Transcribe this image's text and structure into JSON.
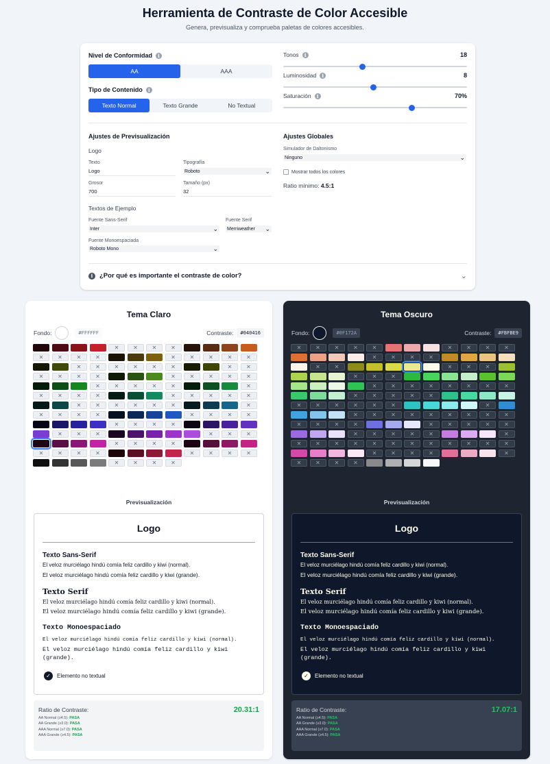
{
  "header": {
    "title": "Herramienta de Contraste de Color Accesible",
    "subtitle": "Genera, previsualiza y comprueba paletas de colores accesibles."
  },
  "settings": {
    "conformance": {
      "label": "Nivel de Conformidad",
      "options": [
        "AA",
        "AAA"
      ],
      "selected": "AA"
    },
    "content_type": {
      "label": "Tipo de Contenido",
      "options": [
        "Texto Normal",
        "Texto Grande",
        "No Textual"
      ],
      "selected": "Texto Normal"
    },
    "sliders": [
      {
        "label": "Tonos",
        "value": "18",
        "fraction": 0.43
      },
      {
        "label": "Luminosidad",
        "value": "8",
        "fraction": 0.49
      },
      {
        "label": "Saturación",
        "value": "70%",
        "fraction": 0.7
      }
    ],
    "preview_settings": {
      "title": "Ajustes de Previsualización",
      "logo_heading": "Logo",
      "text_label": "Texto",
      "text_value": "Logo",
      "typography_label": "Tipografía",
      "typography_value": "Roboto",
      "weight_label": "Grosor",
      "weight_value": "700",
      "size_label": "Tamaño (px)",
      "size_value": "32",
      "samples_heading": "Textos de Ejemplo",
      "sans_label": "Fuente Sans-Serif",
      "sans_value": "Inter",
      "serif_label": "Fuente Serif",
      "serif_value": "Merriweather",
      "mono_label": "Fuente Monoespaciada",
      "mono_value": "Roboto Mono"
    },
    "global_settings": {
      "title": "Ajustes Globales",
      "simulator_label": "Simulador de Daltonismo",
      "simulator_value": "Ninguno",
      "show_all_label": "Mostrar todos los colores",
      "min_ratio_label": "Ratio mínimo:",
      "min_ratio_value": "4.5:1"
    },
    "faq": "¿Por qué es importante el contraste de color?"
  },
  "light_theme": {
    "title": "Tema Claro",
    "bg_label": "Fondo:",
    "bg_hex": "#FFFFFF",
    "bg_color": "#ffffff",
    "contrast_label": "Contraste:",
    "contrast_hex": "#040416",
    "selected_index": 120,
    "grid": [
      "#22060a",
      "#4e0c12",
      "#8a1219",
      "#c42027",
      "x",
      "x",
      "x",
      "x",
      "#261208",
      "#5a2b10",
      "#8f4519",
      "#c75c1c",
      "x",
      "x",
      "x",
      "x",
      "#1b1404",
      "#4b3a0b",
      "#7c600d",
      "x",
      "x",
      "x",
      "x",
      "x",
      "#161704",
      "#414b08",
      "x",
      "x",
      "x",
      "x",
      "x",
      "x",
      "#1a1b04",
      "#3f4407",
      "x",
      "x",
      "x",
      "x",
      "x",
      "x",
      "#0c1a06",
      "#2b5312",
      "#4b8a1b",
      "x",
      "x",
      "x",
      "x",
      "x",
      "#061c0a",
      "#0d4e17",
      "#17861f",
      "x",
      "x",
      "x",
      "x",
      "x",
      "#061d0c",
      "#0d5123",
      "#178a3c",
      "x",
      "x",
      "x",
      "x",
      "x",
      "#061b13",
      "#0b4f36",
      "#168a5f",
      "x",
      "x",
      "x",
      "x",
      "x",
      "#061918",
      "#0c4847",
      "x",
      "x",
      "x",
      "x",
      "x",
      "x",
      "#061920",
      "#0d3c52",
      "#17668c",
      "x",
      "x",
      "x",
      "x",
      "x",
      "#06101f",
      "#0c2858",
      "#17449a",
      "#2058c2",
      "x",
      "x",
      "x",
      "x",
      "#040416",
      "#1b1767",
      "#28229e",
      "#3a31c2",
      "x",
      "x",
      "x",
      "x",
      "#0d0416",
      "#2b1366",
      "#4a22a0",
      "#6430c2",
      "#7b3cd1",
      "x",
      "x",
      "x",
      "#1b0622",
      "#4c136a",
      "#7a22a8",
      "#9d35cc",
      "#ad4de0",
      "x",
      "x",
      "x",
      "#1d0515",
      "#5c0e47",
      "#8c1577",
      "#c223a4",
      "x",
      "x",
      "x",
      "x",
      "#1c0512",
      "#5a0e3b",
      "#8e1863",
      "#c22484",
      "x",
      "x",
      "x",
      "x",
      "#1c0509",
      "#5c0e22",
      "#8d1837",
      "#c2244d",
      "x",
      "x",
      "x",
      "x",
      "#0f0f0f",
      "#333333",
      "#585858",
      "#7b7b7b",
      "x",
      "x",
      "x",
      "x"
    ]
  },
  "dark_theme": {
    "title": "Tema Oscuro",
    "bg_label": "Fondo:",
    "bg_hex": "#0F172A",
    "bg_color": "#0f172a",
    "contrast_label": "Contraste:",
    "contrast_hex": "#FBFBE9",
    "selected_index": 30,
    "grid": [
      "x",
      "x",
      "x",
      "x",
      "x",
      "#e57373",
      "#eeaaaa",
      "#f9e0e0",
      "x",
      "x",
      "x",
      "x",
      "#e07032",
      "#eda382",
      "#f4c8b6",
      "#fbeeea",
      "x",
      "x",
      "x",
      "x",
      "#c28a22",
      "#e0a741",
      "#ebc27e",
      "#f5e0bb",
      "#fcf6ea",
      "x",
      "x",
      "#8e8a1c",
      "#c4c02c",
      "#dcd94c",
      "#ebe98e",
      "#fbfbe9",
      "x",
      "x",
      "x",
      "#9cc032",
      "#acd44f",
      "#c7e48e",
      "#e6f4d2",
      "x",
      "x",
      "x",
      "#2fb841",
      "#4bd45d",
      "#8be394",
      "#c6f0cb",
      "#5ac22e",
      "#7cd958",
      "#a6e68a",
      "#cdf0c0",
      "#ecf9e6",
      "#2fc255",
      "x",
      "x",
      "x",
      "x",
      "x",
      "x",
      "x",
      "x",
      "#38c96d",
      "#7ddc9c",
      "#c2f0d0",
      "x",
      "x",
      "x",
      "x",
      "x",
      "#2dc28a",
      "#47d9a2",
      "#8ee8c6",
      "#c8f5e3",
      "x",
      "x",
      "x",
      "x",
      "x",
      "x",
      "#30c1c2",
      "#4bd8da",
      "#8deaec",
      "#d0f8f8",
      "x",
      "#2f8ed1",
      "#42a3e0",
      "#82c4ec",
      "#c4e2f6",
      "x",
      "x",
      "x",
      "x",
      "x",
      "x",
      "x",
      "x",
      "x",
      "x",
      "x",
      "x",
      "x",
      "#6c70e0",
      "#a7a9f0",
      "#e6e7fb",
      "x",
      "x",
      "x",
      "x",
      "x",
      "#9b6ae0",
      "#c2a7ef",
      "#eae2fb",
      "x",
      "x",
      "x",
      "x",
      "x",
      "#c57be0",
      "#dbaaf0",
      "#f5e6fb",
      "x",
      "x",
      "x",
      "x",
      "x",
      "x",
      "x",
      "x",
      "x",
      "x",
      "x",
      "x",
      "x",
      "#d44aa8",
      "#e67fc7",
      "#f2b6de",
      "#fbeaf5",
      "x",
      "x",
      "x",
      "x",
      "#e0709a",
      "#ecaac3",
      "#f9e3ec",
      "x",
      "x",
      "x",
      "x",
      "x",
      "#8a8a8a",
      "#b0b0b0",
      "#d6d6d6",
      "#f8f8f8"
    ]
  },
  "preview": {
    "heading": "Previsualización",
    "logo": "Logo",
    "sans_title": "Texto Sans-Serif",
    "serif_title": "Texto Serif",
    "mono_title": "Texto Monoespaciado",
    "sample_normal": "El veloz murciélago hindú comía feliz cardillo y kiwi (normal).",
    "sample_large": "El veloz murciélago hindú comía feliz cardillo y kiwi (grande).",
    "non_text": "Elemento no textual"
  },
  "light_ratio": {
    "label": "Ratio de Contraste:",
    "value": "20.31:1",
    "lines": [
      {
        "label": "AA Normal (≥4.5):",
        "result": "PASA"
      },
      {
        "label": "AA Grande (≥3.0):",
        "result": "PASA"
      },
      {
        "label": "AAA Normal (≥7.0):",
        "result": "PASA"
      },
      {
        "label": "AAA Grande (≥4.5):",
        "result": "PASA"
      }
    ]
  },
  "dark_ratio": {
    "label": "Ratio de Contraste:",
    "value": "17.07:1",
    "lines": [
      {
        "label": "AA Normal (≥4.5):",
        "result": "PASA"
      },
      {
        "label": "AA Grande (≥3.0):",
        "result": "PASA"
      },
      {
        "label": "AAA Normal (≥7.0):",
        "result": "PASA"
      },
      {
        "label": "AAA Grande (≥4.5):",
        "result": "PASA"
      }
    ]
  }
}
